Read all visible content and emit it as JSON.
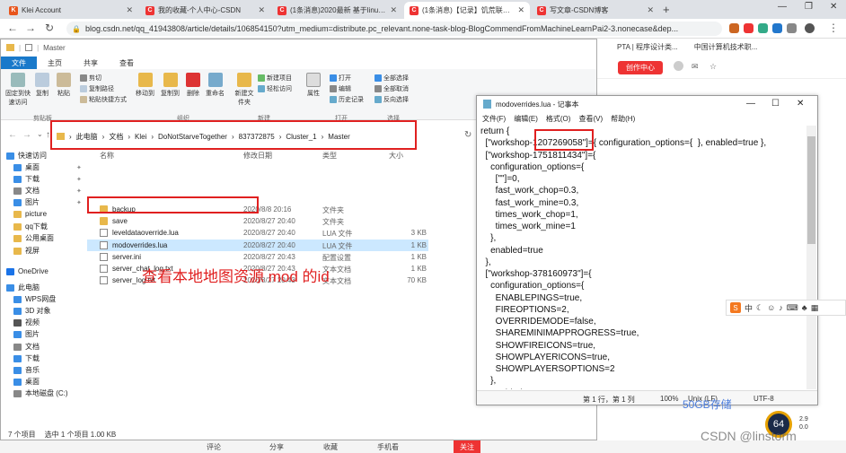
{
  "browser": {
    "tabs": [
      {
        "title": "Klei Account",
        "fav_color": "#e8551c",
        "fav_char": "K"
      },
      {
        "title": "我的收藏-个人中心-CSDN",
        "fav_color": "#e33",
        "fav_char": "C"
      },
      {
        "title": "(1条消息)2020最新 基于linux饥",
        "fav_color": "#e33",
        "fav_char": "C"
      },
      {
        "title": "(1条消息)【记录】饥荒联机版-",
        "fav_color": "#e33",
        "fav_char": "C"
      },
      {
        "title": "写文章-CSDN博客",
        "fav_color": "#e33",
        "fav_char": "C"
      }
    ],
    "new_tab": "+",
    "url": "blog.csdn.net/qq_41943808/article/details/106854150?utm_medium=distribute.pc_relevant.none-task-blog-BlogCommendFromMachineLearnPai2-3.nonecase&dep...",
    "bookmarks": [
      "PTA | 程序设计类...",
      "中国计算机技术职..."
    ],
    "create_center": "创作中心"
  },
  "explorer": {
    "title": "Master",
    "menu_tabs": [
      "文件",
      "主页",
      "共享",
      "查看"
    ],
    "ribbon": {
      "big_buttons": [
        "固定到快速访问",
        "复制",
        "粘贴",
        "移动到",
        "复制到",
        "删除",
        "重命名",
        "新建文件夹",
        "属性"
      ],
      "small_clip": [
        "剪切",
        "复制路径",
        "粘贴快捷方式"
      ],
      "small_new": [
        "新建项目",
        "轻松访问"
      ],
      "small_open": [
        "打开",
        "编辑",
        "历史记录"
      ],
      "small_select": [
        "全部选择",
        "全部取消",
        "反向选择"
      ],
      "groups": [
        "剪贴板",
        "组织",
        "新建",
        "打开",
        "选择"
      ]
    },
    "breadcrumb": [
      "此电脑",
      "文档",
      "Klei",
      "DoNotStarveTogether",
      "837372875",
      "Cluster_1",
      "Master"
    ],
    "nav": [
      {
        "label": "快速访问",
        "color": "#3a8ee6"
      },
      {
        "label": "桌面",
        "color": "#3a8ee6"
      },
      {
        "label": "下载",
        "color": "#3a8ee6"
      },
      {
        "label": "文档",
        "color": "#888"
      },
      {
        "label": "图片",
        "color": "#3a8ee6"
      },
      {
        "label": "picture",
        "color": "#e8b84b"
      },
      {
        "label": "qq下载",
        "color": "#e8b84b"
      },
      {
        "label": "公用桌面",
        "color": "#e8b84b"
      },
      {
        "label": "视屏",
        "color": "#e8b84b"
      },
      {
        "label": "OneDrive",
        "color": "#1a73e8"
      },
      {
        "label": "此电脑",
        "color": "#3a8ee6"
      },
      {
        "label": "WPS网盘",
        "color": "#3a8ee6"
      },
      {
        "label": "3D 对象",
        "color": "#3a8ee6"
      },
      {
        "label": "视频",
        "color": "#555"
      },
      {
        "label": "图片",
        "color": "#3a8ee6"
      },
      {
        "label": "文档",
        "color": "#888"
      },
      {
        "label": "下载",
        "color": "#3a8ee6"
      },
      {
        "label": "音乐",
        "color": "#3a8ee6"
      },
      {
        "label": "桌面",
        "color": "#3a8ee6"
      },
      {
        "label": "本地磁盘 (C:)",
        "color": "#888"
      }
    ],
    "headers": [
      "名称",
      "修改日期",
      "类型",
      "大小"
    ],
    "files": [
      {
        "name": "backup",
        "date": "2020/8/8 20:16",
        "type": "文件夹",
        "size": "",
        "kind": "folder"
      },
      {
        "name": "save",
        "date": "2020/8/27 20:40",
        "type": "文件夹",
        "size": "",
        "kind": "folder"
      },
      {
        "name": "leveldataoverride.lua",
        "date": "2020/8/27 20:40",
        "type": "LUA 文件",
        "size": "3 KB",
        "kind": "doc"
      },
      {
        "name": "modoverrides.lua",
        "date": "2020/8/27 20:40",
        "type": "LUA 文件",
        "size": "1 KB",
        "kind": "doc"
      },
      {
        "name": "server.ini",
        "date": "2020/8/27 20:43",
        "type": "配置设置",
        "size": "1 KB",
        "kind": "doc"
      },
      {
        "name": "server_chat_log.txt",
        "date": "2020/8/27 20:43",
        "type": "文本文档",
        "size": "1 KB",
        "kind": "doc"
      },
      {
        "name": "server_log.txt",
        "date": "2020/8/27 20:43",
        "type": "文本文档",
        "size": "70 KB",
        "kind": "doc"
      }
    ],
    "status": {
      "count": "7 个项目",
      "selected": "选中 1 个项目 1.00 KB"
    }
  },
  "annotation": "查看本地地图资源 mod 的id",
  "notepad": {
    "title": "modoverrides.lua - 记事本",
    "menu": [
      "文件(F)",
      "编辑(E)",
      "格式(O)",
      "查看(V)",
      "帮助(H)"
    ],
    "lines": [
      "return {",
      "  [\"workshop-1207269058\"]={ configuration_options={  }, enabled=true },",
      "  [\"workshop-1751811434\"]={",
      "    configuration_options={",
      "      [\"\"]=0,",
      "      fast_work_chop=0.3,",
      "      fast_work_mine=0.3,",
      "      times_work_chop=1,",
      "      times_work_mine=1",
      "    },",
      "    enabled=true",
      "  },",
      "  [\"workshop-378160973\"]={",
      "    configuration_options={",
      "      ENABLEPINGS=true,",
      "      FIREOPTIONS=2,",
      "      OVERRIDEMODE=false,",
      "      SHAREMINIMAPPROGRESS=true,",
      "      SHOWFIREICONS=true,",
      "      SHOWPLAYERICONS=true,",
      "      SHOWPLAYERSOPTIONS=2",
      "    },",
      "    enabled=true"
    ],
    "status": {
      "position": "第 1 行，第 1 列",
      "zoom": "100%",
      "eol": "Unix (LF)",
      "encoding": "UTF-8"
    }
  },
  "bottom": {
    "items": [
      "评论",
      "分享",
      "收藏",
      "手机看"
    ],
    "close": "关注"
  },
  "ime": {
    "logo": "S",
    "label": "中"
  },
  "sidebar_ad": "50GB存储",
  "gauge": "64",
  "net_speed": [
    "2.9",
    "0.0"
  ],
  "watermark": "CSDN @linstorm"
}
